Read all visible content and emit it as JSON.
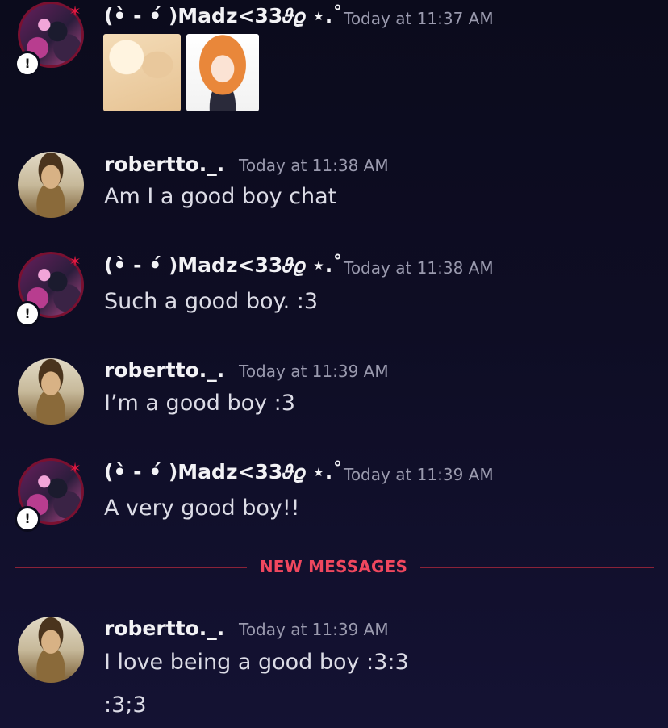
{
  "messages": [
    {
      "author": "(•̀ - •́ )Madz<33𝜗𝜚 ⋆.˚",
      "timestamp": "Today at 11:37 AM",
      "text": "",
      "attachments": [
        "image-attachment-1",
        "image-attachment-2"
      ]
    },
    {
      "author": "robertto._.",
      "timestamp": "Today at 11:38 AM",
      "text": "Am I a good boy chat"
    },
    {
      "author": "(•̀ - •́ )Madz<33𝜗𝜚 ⋆.˚",
      "timestamp": "Today at 11:38 AM",
      "text": "Such a good boy. :3"
    },
    {
      "author": "robertto._.",
      "timestamp": "Today at 11:39 AM",
      "text": "I’m a good boy :3"
    },
    {
      "author": "(•̀ - •́ )Madz<33𝜗𝜚 ⋆.˚",
      "timestamp": "Today at 11:39 AM",
      "text": "A very good boy!!"
    },
    {
      "author": "robertto._.",
      "timestamp": "Today at 11:39 AM",
      "text": "I love being a good boy :3:3",
      "text2": ":3;3"
    }
  ],
  "divider": {
    "label": "NEW MESSAGES"
  },
  "badge": {
    "symbol": "!"
  },
  "colors": {
    "background": "#0e0d24",
    "divider": "#f0475e",
    "timestamp": "#9a9aae",
    "username": "#f2f2f5"
  }
}
